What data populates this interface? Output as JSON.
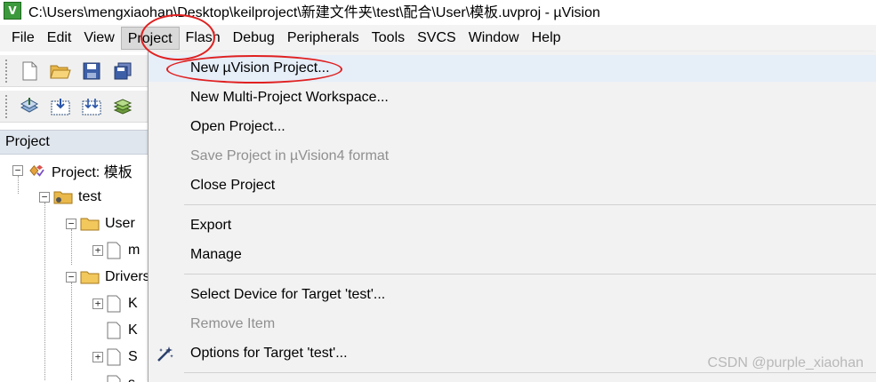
{
  "window": {
    "logo_text": "V",
    "title": "C:\\Users\\mengxiaohan\\Desktop\\keilproject\\新建文件夹\\test\\配合\\User\\模板.uvproj - µVision"
  },
  "menubar": {
    "items": [
      {
        "label": "File"
      },
      {
        "label": "Edit"
      },
      {
        "label": "View"
      },
      {
        "label": "Project"
      },
      {
        "label": "Flash"
      },
      {
        "label": "Debug"
      },
      {
        "label": "Peripherals"
      },
      {
        "label": "Tools"
      },
      {
        "label": "SVCS"
      },
      {
        "label": "Window"
      },
      {
        "label": "Help"
      }
    ]
  },
  "project_panel": {
    "header": "Project",
    "tree": [
      {
        "label": "Project: 模板",
        "expander": "−"
      },
      {
        "label": "test",
        "expander": "−"
      },
      {
        "label": "User",
        "expander": "−"
      },
      {
        "label": "m",
        "expander": "+"
      },
      {
        "label": "Drivers",
        "expander": "−"
      },
      {
        "label": "K",
        "expander": "+"
      },
      {
        "label": "K",
        "expander": ""
      },
      {
        "label": "S",
        "expander": "+"
      },
      {
        "label": "s",
        "expander": ""
      }
    ]
  },
  "project_menu": {
    "items": [
      {
        "label": "New µVision Project...",
        "enabled": true
      },
      {
        "label": "New Multi-Project Workspace...",
        "enabled": true
      },
      {
        "label": "Open Project...",
        "enabled": true
      },
      {
        "label": "Save Project in µVision4 format",
        "enabled": false
      },
      {
        "label": "Close Project",
        "enabled": true
      },
      {
        "label": "Export",
        "enabled": true
      },
      {
        "label": "Manage",
        "enabled": true
      },
      {
        "label": "Select Device for Target 'test'...",
        "enabled": true
      },
      {
        "label": "Remove Item",
        "enabled": false
      },
      {
        "label": "Options for Target 'test'...",
        "enabled": true,
        "icon": "magic-wand-icon"
      }
    ]
  },
  "watermark": "CSDN @purple_xiaohan",
  "colors": {
    "annotation": "#e02020",
    "menu_background": "#f2f2f2",
    "panel_header": "#e0e6ee"
  }
}
